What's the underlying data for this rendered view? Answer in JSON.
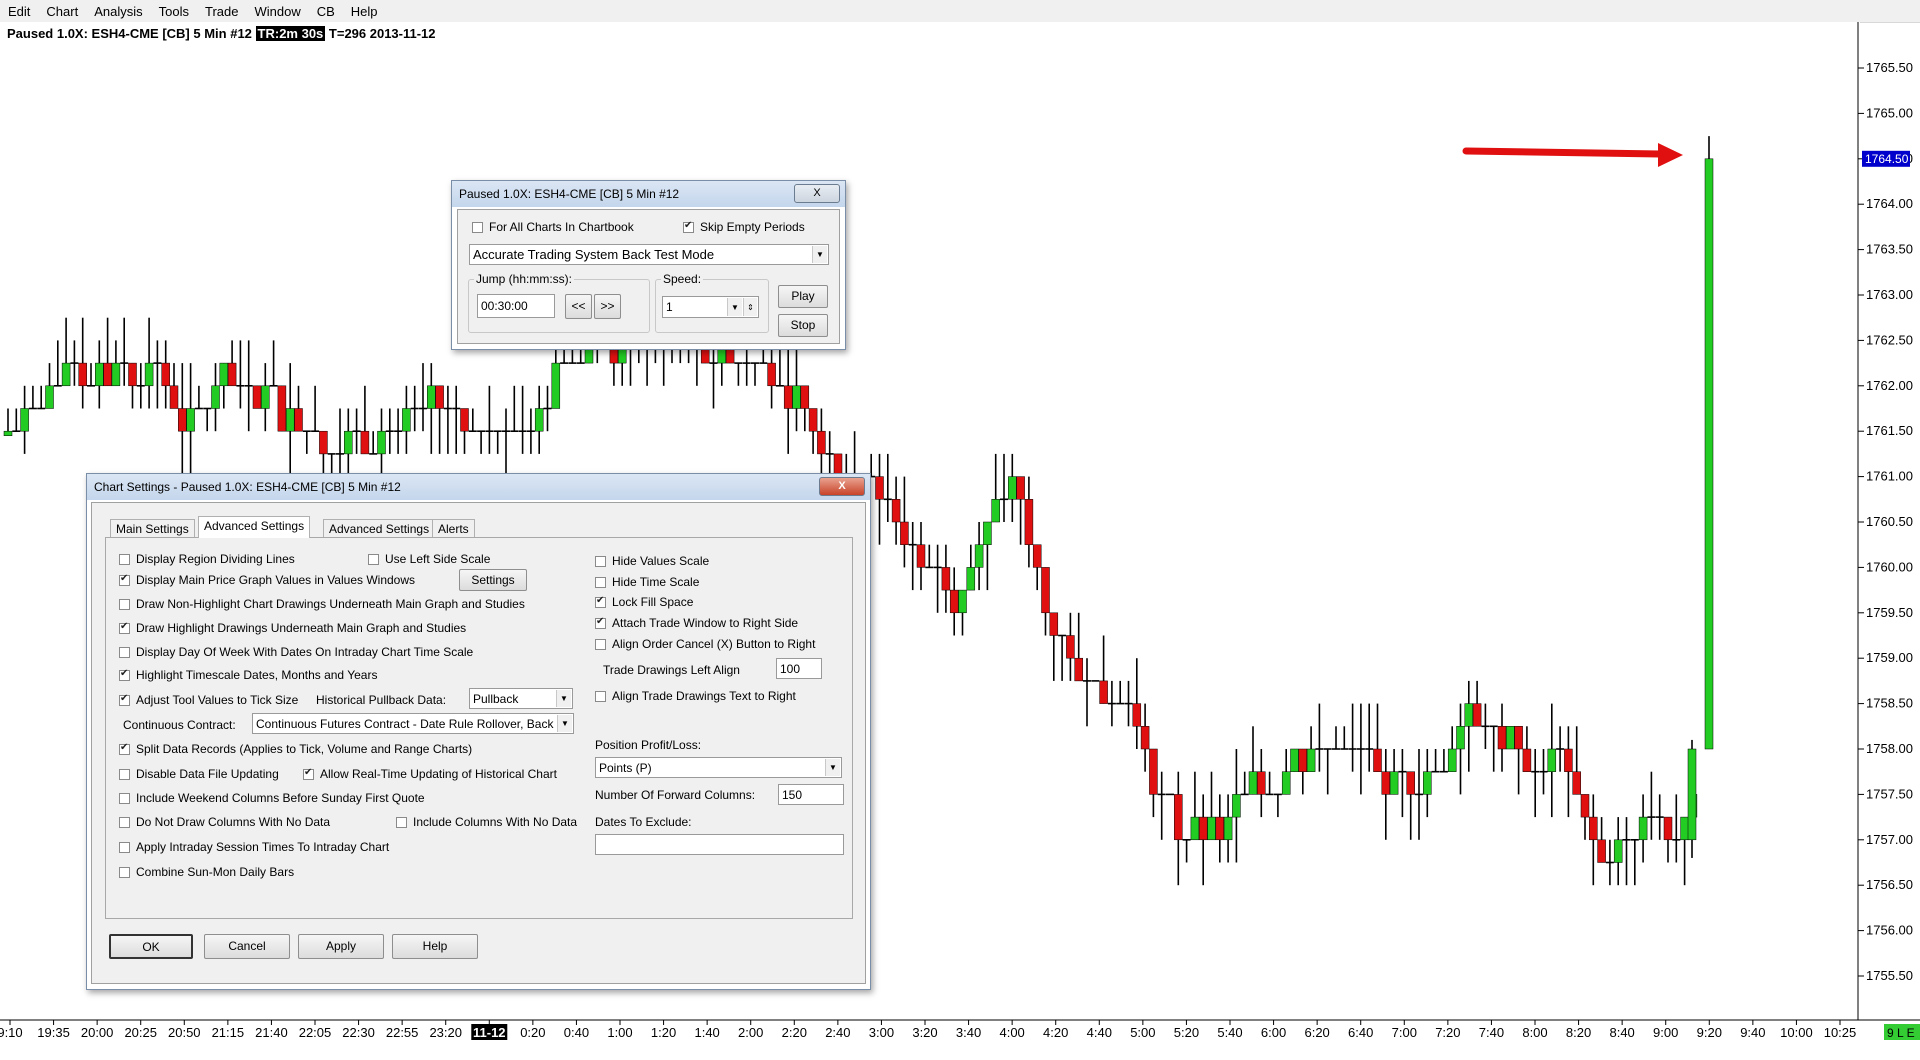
{
  "menu": [
    "Edit",
    "Chart",
    "Analysis",
    "Tools",
    "Trade",
    "Window",
    "CB",
    "Help"
  ],
  "chart_title": {
    "prefix": "Paused 1.0X: ESH4-CME [CB]  5 Min   #12",
    "tr": "TR:2m 30s",
    "suffix": "T=296 2013-11-12"
  },
  "chart_data": {
    "type": "candlestick",
    "symbol": "ESH4-CME [CB]",
    "interval": "5 Min",
    "date": "2013-11-12",
    "ylim": [
      1755.0,
      1766.0
    ],
    "y_ticks": [
      "1765.50",
      "1765.00",
      "1764.50",
      "1764.00",
      "1763.50",
      "1763.00",
      "1762.50",
      "1762.00",
      "1761.50",
      "1761.00",
      "1760.50",
      "1760.00",
      "1759.50",
      "1759.00",
      "1758.50",
      "1758.00",
      "1757.50",
      "1757.00",
      "1756.50",
      "1756.00",
      "1755.50"
    ],
    "last_price": "1764.50",
    "x_ticks": [
      "9:10",
      "19:35",
      "20:00",
      "20:25",
      "20:50",
      "21:15",
      "21:40",
      "22:05",
      "22:30",
      "22:55",
      "23:20",
      "11-12",
      "0:20",
      "0:40",
      "1:00",
      "1:20",
      "1:40",
      "2:00",
      "2:20",
      "2:40",
      "3:00",
      "3:20",
      "3:40",
      "4:00",
      "4:20",
      "4:40",
      "5:00",
      "5:20",
      "5:40",
      "6:00",
      "6:20",
      "6:40",
      "7:00",
      "7:20",
      "7:40",
      "8:00",
      "8:20",
      "8:40",
      "9:00",
      "9:20",
      "9:40",
      "10:00",
      "10:25"
    ],
    "highlighted_x_tick": "11-12",
    "corner_label": "9 L E",
    "colors": {
      "up": "#22cc22",
      "down": "#e01010",
      "price_marker": "#0000cc",
      "arrow": "#e01010",
      "highlight": "#000000"
    },
    "candles_ohlc": [
      [
        1761.5,
        1761.5,
        1761.3,
        1761.3
      ],
      [
        1761.5,
        1761.5,
        1761.3,
        1761.3
      ],
      [
        1761.5,
        1761.5,
        1761.3,
        1761.3
      ],
      [
        1761.5,
        1761.5,
        1761.3,
        1761.3
      ],
      [
        1761.5,
        1761.5,
        1761.3,
        1761.3
      ],
      [
        1761.5,
        1761.5,
        1761.3,
        1761.3
      ],
      [
        1761.5,
        1761.5,
        1761.3,
        1761.3
      ],
      [
        1761.5,
        1761.5,
        1761.3,
        1761.3
      ],
      [
        1761.5,
        1761.5,
        1761.3,
        1761.3
      ],
      [
        1761.5,
        1761.5,
        1761.3,
        1761.3
      ],
      [
        1761.5,
        1761.5,
        1761.3,
        1761.3
      ],
      [
        1761.5,
        1761.5,
        1761.3,
        1761.3
      ],
      [
        1761.5,
        1761.5,
        1761.3,
        1761.3
      ],
      [
        1761.5,
        1761.5,
        1761.3,
        1761.3
      ],
      [
        1761.5,
        1761.5,
        1761.3,
        1761.3
      ],
      [
        1761.5,
        1761.5,
        1761.3,
        1761.3
      ],
      [
        1761.5,
        1761.5,
        1761.3,
        1761.3
      ],
      [
        1761.5,
        1761.5,
        1761.3,
        1761.3
      ],
      [
        1761.5,
        1761.5,
        1761.3,
        1761.3
      ],
      [
        1761.5,
        1761.5,
        1761.3,
        1761.3
      ],
      [
        1761.5,
        1761.5,
        1761.3,
        1761.3
      ],
      [
        1761.5,
        1761.5,
        1761.3,
        1761.3
      ],
      [
        1761.5,
        1761.5,
        1761.3,
        1761.3
      ],
      [
        1761.5,
        1761.5,
        1761.3,
        1761.3
      ],
      [
        1761.5,
        1761.5,
        1761.3,
        1761.3
      ],
      [
        1761.5,
        1761.5,
        1761.3,
        1761.3
      ],
      [
        1761.5,
        1761.5,
        1761.3,
        1761.3
      ],
      [
        1761.5,
        1761.5,
        1761.3,
        1761.3
      ],
      [
        1761.5,
        1761.5,
        1761.3,
        1761.3
      ],
      [
        1761.5,
        1761.5,
        1761.3,
        1761.3
      ]
    ]
  },
  "replay_dialog": {
    "title": "Paused 1.0X: ESH4-CME [CB]  5 Min   #12",
    "close_label": "X",
    "for_all_charts": "For All Charts In Chartbook",
    "skip_empty": "Skip Empty Periods",
    "mode": "Accurate Trading System Back Test Mode",
    "jump_label": "Jump (hh:mm:ss):",
    "jump_value": "00:30:00",
    "back": "<<",
    "forward": ">>",
    "speed_label": "Speed:",
    "speed_value": "1",
    "play": "Play",
    "stop": "Stop"
  },
  "settings_dialog": {
    "title": "Chart Settings - Paused 1.0X: ESH4-CME [CB]  5 Min   #12",
    "close_label": "X",
    "tabs": [
      "Main Settings",
      "Advanced Settings",
      "Advanced Settings 2",
      "Alerts"
    ],
    "left": {
      "display_region": "Display Region Dividing Lines",
      "use_left_scale": "Use Left Side Scale",
      "display_main_values": "Display Main Price Graph Values in Values Windows",
      "settings_btn": "Settings",
      "draw_non_highlight": "Draw Non-Highlight Chart Drawings Underneath Main Graph and Studies",
      "draw_highlight": "Draw Highlight Drawings Underneath Main Graph and Studies",
      "display_day_of_week": "Display Day Of Week With Dates On Intraday Chart Time Scale",
      "highlight_timescale": "Highlight Timescale Dates, Months and Years",
      "adjust_tool": "Adjust Tool Values to Tick Size",
      "hist_pullback_label": "Historical Pullback Data:",
      "hist_pullback_value": "Pullback",
      "continuous_label": "Continuous Contract:",
      "continuous_value": "Continuous Futures Contract - Date Rule Rollover, Back",
      "split_data": "Split Data Records (Applies to Tick, Volume and Range Charts)",
      "disable_updating": "Disable Data File Updating",
      "allow_realtime": "Allow Real-Time Updating of Historical Chart",
      "include_weekend": "Include Weekend Columns Before Sunday First Quote",
      "do_not_draw": "Do Not Draw Columns With No Data",
      "include_columns": "Include Columns With No Data",
      "apply_intraday": "Apply Intraday Session Times To Intraday Chart",
      "combine_sunmon": "Combine Sun-Mon Daily Bars"
    },
    "right": {
      "hide_values": "Hide Values Scale",
      "hide_time": "Hide Time Scale",
      "lock_fill": "Lock Fill Space",
      "attach_trade": "Attach Trade Window to Right Side",
      "align_order": "Align Order Cancel (X) Button to Right",
      "trade_left_align_label": "Trade Drawings Left Align",
      "trade_left_align_value": "100",
      "align_trade_text": "Align Trade Drawings Text to Right",
      "position_pl_label": "Position Profit/Loss:",
      "position_pl_value": "Points (P)",
      "forward_cols_label": "Number Of Forward Columns:",
      "forward_cols_value": "150",
      "dates_exclude_label": "Dates To Exclude:",
      "dates_exclude_value": ""
    },
    "buttons": {
      "ok": "OK",
      "cancel": "Cancel",
      "apply": "Apply",
      "help": "Help"
    }
  }
}
